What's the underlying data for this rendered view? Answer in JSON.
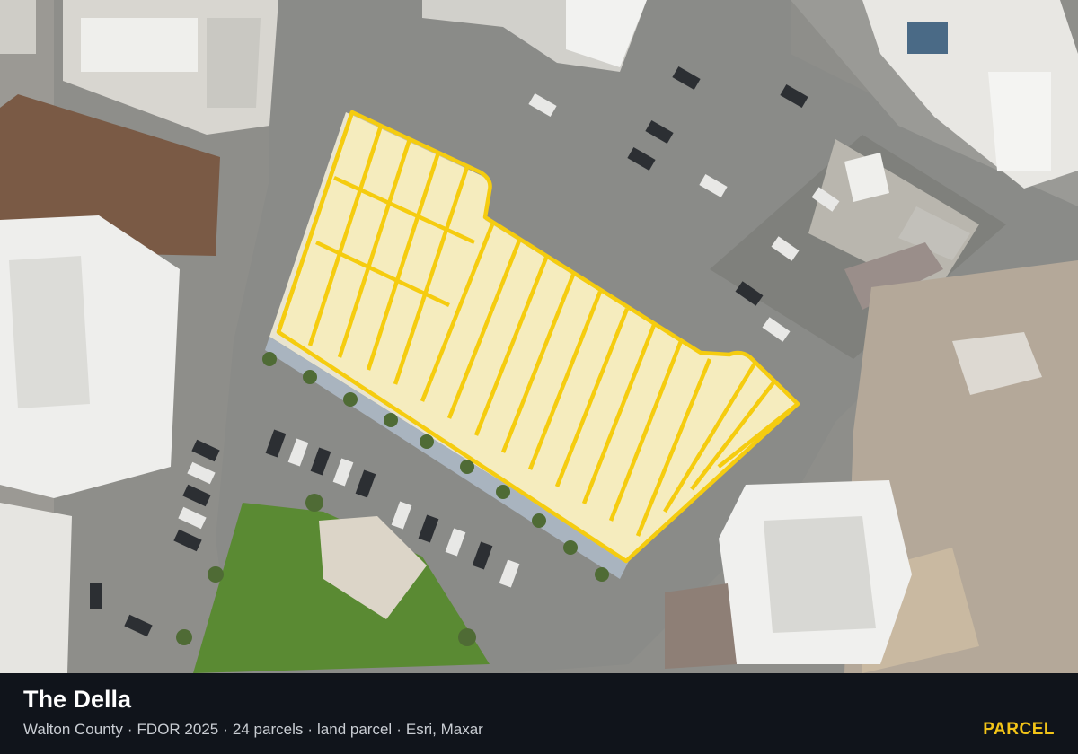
{
  "footer": {
    "title": "The Della",
    "meta": [
      "Walton County",
      "FDOR 2025",
      "24 parcels",
      "land parcel",
      "Esri, Maxar"
    ],
    "badge": "PARCEL"
  },
  "map": {
    "imagery": "aerial-satellite",
    "parcel_count": 24,
    "parcel_outline_color": "#f5cc0f",
    "parcel_fill_color": "#fff3b0"
  }
}
